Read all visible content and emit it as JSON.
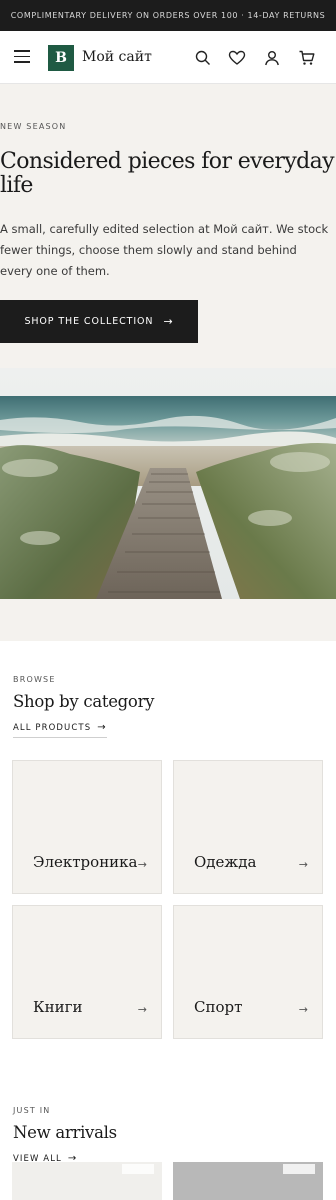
{
  "announcement": "COMPLIMENTARY DELIVERY ON ORDERS OVER 100 · 14-DAY RETURNS",
  "header": {
    "logo_letter": "B",
    "site_name": "Мой сайт",
    "icons": [
      "menu-icon",
      "search-icon",
      "heart-icon",
      "user-icon",
      "cart-icon"
    ]
  },
  "hero": {
    "eyebrow": "NEW SEASON",
    "title": "Considered pieces for everyday life",
    "body": "A small, carefully edited selection at Мой сайт. We stock fewer things, choose them slowly and stand behind every one of them.",
    "cta": "SHOP THE COLLECTION"
  },
  "categories_section": {
    "eyebrow": "BROWSE",
    "title": "Shop by category",
    "link": "ALL PRODUCTS",
    "items": [
      {
        "name": "Электроника"
      },
      {
        "name": "Одежда"
      },
      {
        "name": "Книги"
      },
      {
        "name": "Спорт"
      }
    ]
  },
  "arrivals_section": {
    "eyebrow": "JUST IN",
    "title": "New arrivals",
    "link": "VIEW ALL"
  },
  "colors": {
    "brand": "#1f5a43",
    "dark": "#1c1c1c",
    "surface": "#f4f2ee"
  }
}
